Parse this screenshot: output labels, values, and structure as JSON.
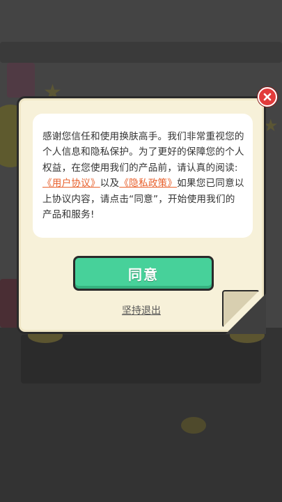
{
  "dialog": {
    "message": {
      "part1": "感谢您信任和使用换肤高手。我们非常重视您的个人信息和隐私保护。为了更好的保障您的个人权益，在您使用我们的产品前，请认真的阅读:",
      "user_agreement_link": "《用户协议》",
      "and_text": "以及",
      "privacy_policy_link": "《隐私政策》",
      "part2": "如果您已同意以上协议内容，请点击“同意”，开始使用我们的产品和服务!"
    },
    "agree_label": "同意",
    "exit_label": "坚持退出",
    "close_icon": "close-icon"
  },
  "colors": {
    "card_bg": "#f7f1d9",
    "agree_button": "#47d19a",
    "link": "#e8602c",
    "close_button": "#e23b3b"
  }
}
